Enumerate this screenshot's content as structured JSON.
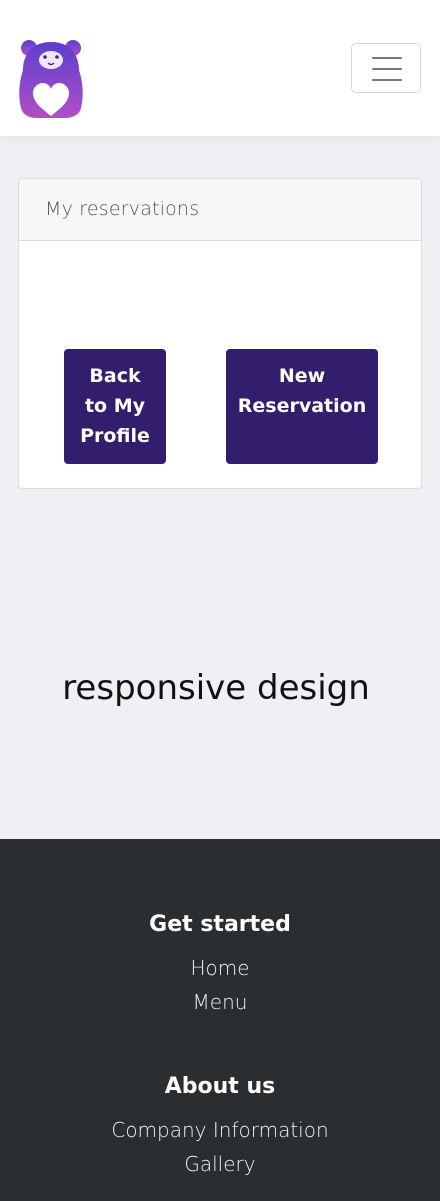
{
  "header": {
    "logo_icon": "bear-heart-logo",
    "menu_icon": "hamburger-icon"
  },
  "card": {
    "title": "My reservations",
    "back_button_lines": [
      "Back",
      "to My",
      "Profile"
    ],
    "new_button_lines": [
      "New",
      "Reservation"
    ]
  },
  "tagline": "responsive design",
  "footer": {
    "section1_title": "Get started",
    "section1_links": [
      "Home",
      "Menu"
    ],
    "section2_title": "About us",
    "section2_links": [
      "Company Information",
      "Gallery"
    ]
  },
  "colors": {
    "button_bg": "#331e6e",
    "footer_bg": "#2b2e31",
    "page_bg": "#eff0f5",
    "logo_gradient_top": "#5b3fcf",
    "logo_gradient_bottom": "#b24ec6"
  }
}
